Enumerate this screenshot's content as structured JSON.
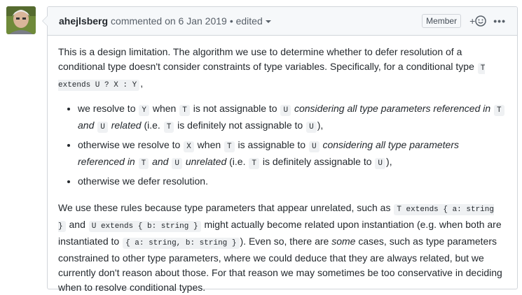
{
  "comment": {
    "author": "ahejlsberg",
    "commented_on": "commented on 6 Jan 2019",
    "edited_label": "• edited",
    "role_badge": "Member",
    "react_plus": "+",
    "more_label": "•••"
  },
  "body": {
    "p1": {
      "t1": "This is a design limitation. The algorithm we use to determine whether to defer resolution of a conditional type doesn't consider constraints of type variables. Specifically, for a conditional type ",
      "c1": "T extends U ? X : Y",
      "t2": ","
    },
    "bullet1": {
      "t1": "we resolve to ",
      "c1": "Y",
      "t2": " when ",
      "c2": "T",
      "t3": " is not assignable to ",
      "c3": "U",
      "t4": " ",
      "e1": "considering all type parameters referenced in ",
      "c4": "T",
      "e2": " and ",
      "c5": "U",
      "e3": " related",
      "t5": " (i.e. ",
      "c6": "T",
      "t6": " is definitely not assignable to ",
      "c7": "U",
      "t7": "),"
    },
    "bullet2": {
      "t1": "otherwise we resolve to ",
      "c1": "X",
      "t2": " when ",
      "c2": "T",
      "t3": " is assignable to ",
      "c3": "U",
      "t4": " ",
      "e1": "considering all type parameters referenced in ",
      "c4": "T",
      "e2": " and ",
      "c5": "U",
      "e3": " unrelated",
      "t5": " (i.e. ",
      "c6": "T",
      "t6": " is definitely assignable to ",
      "c7": "U",
      "t7": "),"
    },
    "bullet3": {
      "t1": "otherwise we defer resolution."
    },
    "p2": {
      "t1": "We use these rules because type parameters that appear unrelated, such as ",
      "c1": "T extends { a: string }",
      "t2": " and ",
      "c2": "U extends { b: string }",
      "t3": " might actually become related upon instantiation (e.g. when both are instantiated to ",
      "c3": "{ a: string, b: string }",
      "t4": "). Even so, there are ",
      "e1": "some",
      "t5": " cases, such as type parameters constrained to other type parameters, where we could deduce that they are always related, but we currently don't reason about those. For that reason we may sometimes be too conservative in deciding when to resolve conditional types."
    }
  }
}
